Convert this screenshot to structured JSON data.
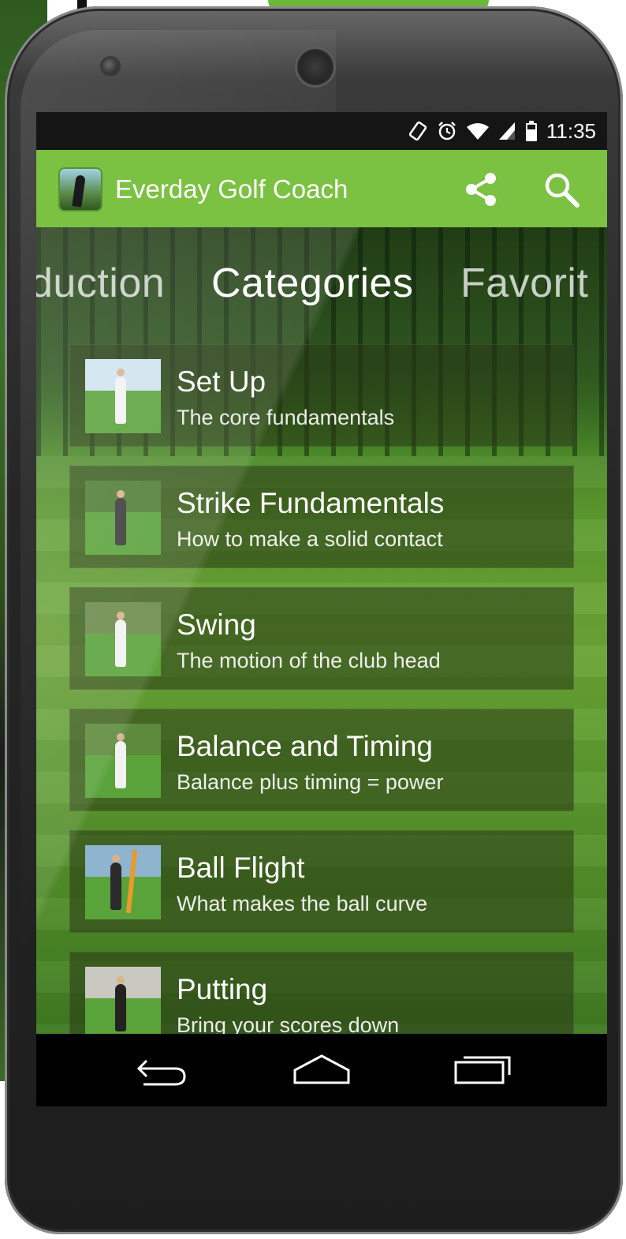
{
  "status_bar": {
    "time": "11:35",
    "icons": [
      "rotate-icon",
      "alarm-icon",
      "wifi-icon",
      "signal-icon",
      "battery-icon"
    ]
  },
  "app_bar": {
    "title": "Everday Golf Coach",
    "logo": "golfer-logo-icon",
    "actions": [
      "share-icon",
      "search-icon"
    ],
    "color": "#7bc142"
  },
  "tabs": [
    {
      "label": "duction",
      "active": false
    },
    {
      "label": "Categories",
      "active": true
    },
    {
      "label": "Favorit",
      "active": false
    }
  ],
  "categories": [
    {
      "title": "Set Up",
      "subtitle": "The core fundamentals"
    },
    {
      "title": "Strike Fundamentals",
      "subtitle": "How to make a solid contact"
    },
    {
      "title": "Swing",
      "subtitle": "The motion of the club head"
    },
    {
      "title": "Balance and Timing",
      "subtitle": "Balance plus timing = power"
    },
    {
      "title": "Ball Flight",
      "subtitle": "What makes the ball curve"
    },
    {
      "title": "Putting",
      "subtitle": "Bring your scores down"
    }
  ],
  "nav_bar": {
    "buttons": [
      "back-icon",
      "home-icon",
      "recents-icon"
    ]
  }
}
